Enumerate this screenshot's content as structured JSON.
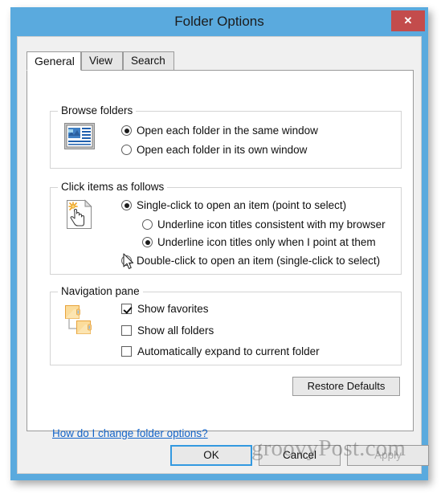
{
  "window": {
    "title": "Folder Options",
    "close_label": "✕",
    "frame_color": "#5aaade",
    "close_color": "#c34c4c"
  },
  "tabs": [
    {
      "label": "General",
      "active": true
    },
    {
      "label": "View",
      "active": false
    },
    {
      "label": "Search",
      "active": false
    }
  ],
  "groups": {
    "browse": {
      "title": "Browse folders",
      "icon": "window-preview-icon",
      "options": [
        {
          "label": "Open each folder in the same window",
          "checked": true
        },
        {
          "label": "Open each folder in its own window",
          "checked": false
        }
      ]
    },
    "click": {
      "title": "Click items as follows",
      "icon": "hand-pointer-document-icon",
      "options": [
        {
          "label": "Single-click to open an item (point to select)",
          "checked": true
        },
        {
          "label": "Underline icon titles consistent with my browser",
          "checked": false
        },
        {
          "label": "Underline icon titles only when I point at them",
          "checked": true
        },
        {
          "label": "Double-click to open an item (single-click to select)",
          "checked": false
        }
      ]
    },
    "navigation": {
      "title": "Navigation pane",
      "icon": "folder-tree-icon",
      "options": [
        {
          "label": "Show favorites",
          "checked": true
        },
        {
          "label": "Show all folders",
          "checked": false
        },
        {
          "label": "Automatically expand to current folder",
          "checked": false
        }
      ]
    }
  },
  "restore_defaults_label": "Restore Defaults",
  "help_link_label": "How do I change folder options?",
  "footer": {
    "ok_label": "OK",
    "cancel_label": "Cancel",
    "apply_label": "Apply",
    "apply_disabled": true,
    "focus_color": "#3399e0"
  },
  "watermark": "groovyPost.com"
}
